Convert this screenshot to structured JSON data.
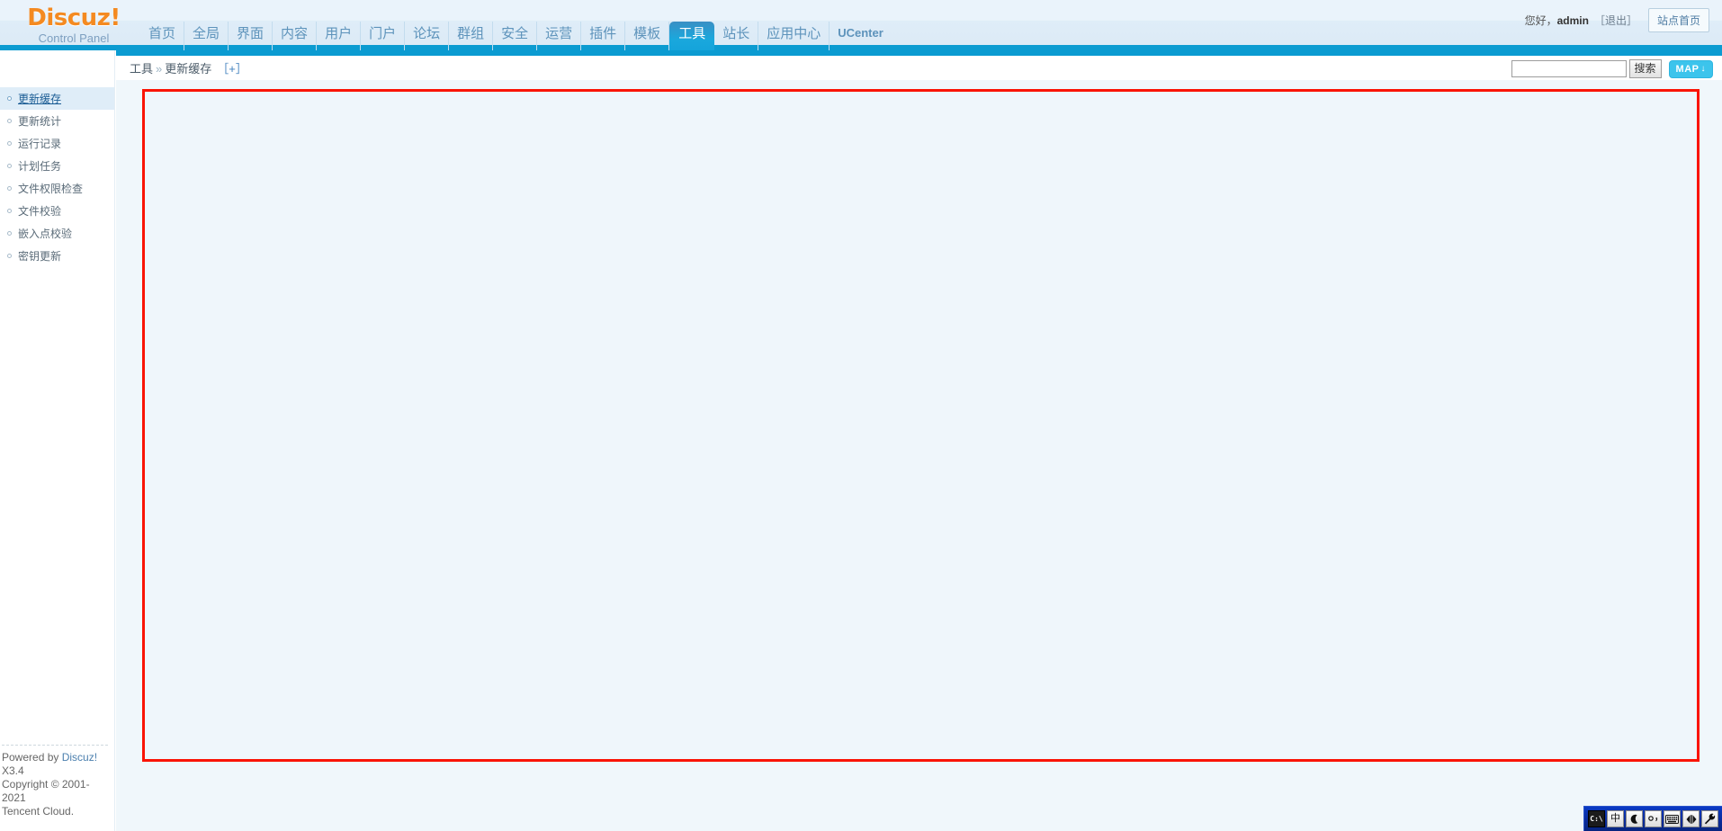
{
  "brand": {
    "name": "Discuz!",
    "subtitle": "Control Panel",
    "accent_color": "#f48a21",
    "nav_bar_color": "#0b9bd1"
  },
  "header": {
    "nav": [
      {
        "label": "首页",
        "active": false,
        "latin": false
      },
      {
        "label": "全局",
        "active": false,
        "latin": false
      },
      {
        "label": "界面",
        "active": false,
        "latin": false
      },
      {
        "label": "内容",
        "active": false,
        "latin": false
      },
      {
        "label": "用户",
        "active": false,
        "latin": false
      },
      {
        "label": "门户",
        "active": false,
        "latin": false
      },
      {
        "label": "论坛",
        "active": false,
        "latin": false
      },
      {
        "label": "群组",
        "active": false,
        "latin": false
      },
      {
        "label": "安全",
        "active": false,
        "latin": false
      },
      {
        "label": "运营",
        "active": false,
        "latin": false
      },
      {
        "label": "插件",
        "active": false,
        "latin": false
      },
      {
        "label": "模板",
        "active": false,
        "latin": false
      },
      {
        "label": "工具",
        "active": true,
        "latin": false
      },
      {
        "label": "站长",
        "active": false,
        "latin": false
      },
      {
        "label": "应用中心",
        "active": false,
        "latin": false
      },
      {
        "label": "UCenter",
        "active": false,
        "latin": true
      }
    ],
    "greeting_prefix": "您好，",
    "username": "admin",
    "logout_label": "［退出］",
    "site_home_label": "站点首页"
  },
  "sidebar": {
    "items": [
      {
        "label": "更新缓存",
        "active": true
      },
      {
        "label": "更新统计",
        "active": false
      },
      {
        "label": "运行记录",
        "active": false
      },
      {
        "label": "计划任务",
        "active": false
      },
      {
        "label": "文件权限检查",
        "active": false
      },
      {
        "label": "文件校验",
        "active": false
      },
      {
        "label": "嵌入点校验",
        "active": false
      },
      {
        "label": "密钥更新",
        "active": false
      }
    ]
  },
  "breadcrumb": {
    "parent": "工具",
    "separator": "»",
    "current": "更新缓存",
    "expand_toggle": "［+］"
  },
  "search": {
    "value": "",
    "placeholder": "",
    "button_label": "搜索",
    "map_label": "MAP",
    "map_arrow": "↓"
  },
  "content": {
    "body_text": "",
    "highlight_color": "#fa1405",
    "background_color": "#eff6fb"
  },
  "footer": {
    "powered_prefix": "Powered by ",
    "powered_link": "Discuz!",
    "version": " X3.4",
    "copyright": "Copyright © 2001-2021",
    "vendor": "Tencent Cloud."
  },
  "ime": {
    "buttons": [
      {
        "name": "input-method-prompt",
        "glyph": "C:\\"
      },
      {
        "name": "chinese-english-toggle",
        "glyph": "中"
      },
      {
        "name": "crescent-mode",
        "glyph": "☽"
      },
      {
        "name": "punctuation-toggle",
        "glyph": "°,"
      },
      {
        "name": "soft-keyboard",
        "glyph": "⌨"
      },
      {
        "name": "input-settings",
        "glyph": "◀▶"
      },
      {
        "name": "toolbox-wrench",
        "glyph": "🔧"
      }
    ]
  }
}
